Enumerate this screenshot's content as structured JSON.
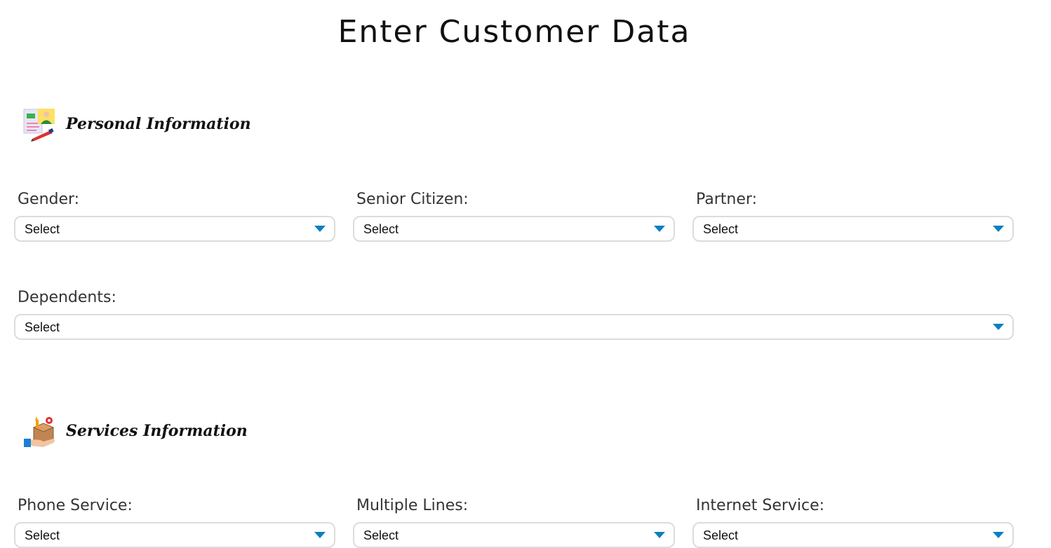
{
  "page": {
    "title": "Enter Customer Data"
  },
  "sections": {
    "personal": {
      "title": "Personal Information",
      "icon": "personal-info-icon"
    },
    "services": {
      "title": "Services Information",
      "icon": "services-box-icon"
    }
  },
  "fields": {
    "gender": {
      "label": "Gender:",
      "value": "Select"
    },
    "senior_citizen": {
      "label": "Senior Citizen:",
      "value": "Select"
    },
    "partner": {
      "label": "Partner:",
      "value": "Select"
    },
    "dependents": {
      "label": "Dependents:",
      "value": "Select"
    },
    "phone_service": {
      "label": "Phone Service:",
      "value": "Select"
    },
    "multiple_lines": {
      "label": "Multiple Lines:",
      "value": "Select"
    },
    "internet_service": {
      "label": "Internet Service:",
      "value": "Select"
    }
  },
  "colors": {
    "accent_arrow": "#0b7fc1",
    "border": "#dcdcdc"
  }
}
